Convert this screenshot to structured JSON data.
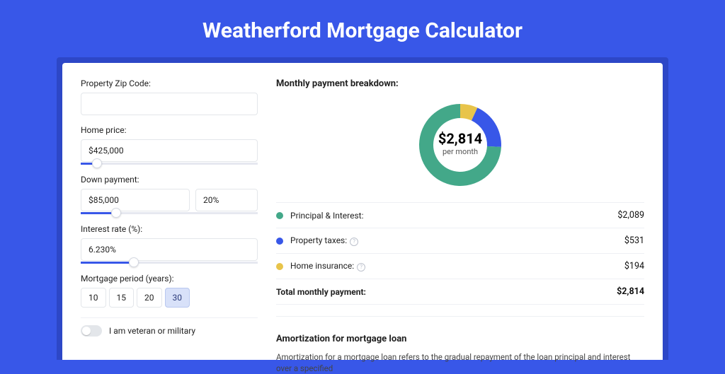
{
  "page_title": "Weatherford Mortgage Calculator",
  "inputs": {
    "zip": {
      "label": "Property Zip Code:",
      "value": ""
    },
    "home_price": {
      "label": "Home price:",
      "value": "$425,000",
      "slider_pct": 9
    },
    "down_payment": {
      "label": "Down payment:",
      "amount": "$85,000",
      "pct": "20%",
      "slider_pct": 20
    },
    "interest": {
      "label": "Interest rate (%):",
      "value": "6.230%",
      "slider_pct": 30
    },
    "period": {
      "label": "Mortgage period (years):",
      "options": [
        "10",
        "15",
        "20",
        "30"
      ],
      "selected": "30"
    },
    "veteran": {
      "label": "I am veteran or military",
      "on": false
    }
  },
  "breakdown": {
    "heading": "Monthly payment breakdown:",
    "center_value": "$2,814",
    "center_sub": "per month",
    "items": [
      {
        "label": "Principal & Interest:",
        "value": "$2,089",
        "color": "#43a889",
        "info": false,
        "pct": 74.2
      },
      {
        "label": "Property taxes:",
        "value": "$531",
        "color": "#3857e8",
        "info": true,
        "pct": 18.9
      },
      {
        "label": "Home insurance:",
        "value": "$194",
        "color": "#e8c44a",
        "info": true,
        "pct": 6.9
      }
    ],
    "total": {
      "label": "Total monthly payment:",
      "value": "$2,814"
    }
  },
  "chart_data": {
    "type": "pie",
    "title": "Monthly payment breakdown",
    "series": [
      {
        "name": "Principal & Interest",
        "value": 2089,
        "color": "#43a889"
      },
      {
        "name": "Property taxes",
        "value": 531,
        "color": "#3857e8"
      },
      {
        "name": "Home insurance",
        "value": 194,
        "color": "#e8c44a"
      }
    ],
    "total": 2814,
    "center_label": "$2,814 per month"
  },
  "amortization": {
    "heading": "Amortization for mortgage loan",
    "text": "Amortization for a mortgage loan refers to the gradual repayment of the loan principal and interest over a specified"
  }
}
